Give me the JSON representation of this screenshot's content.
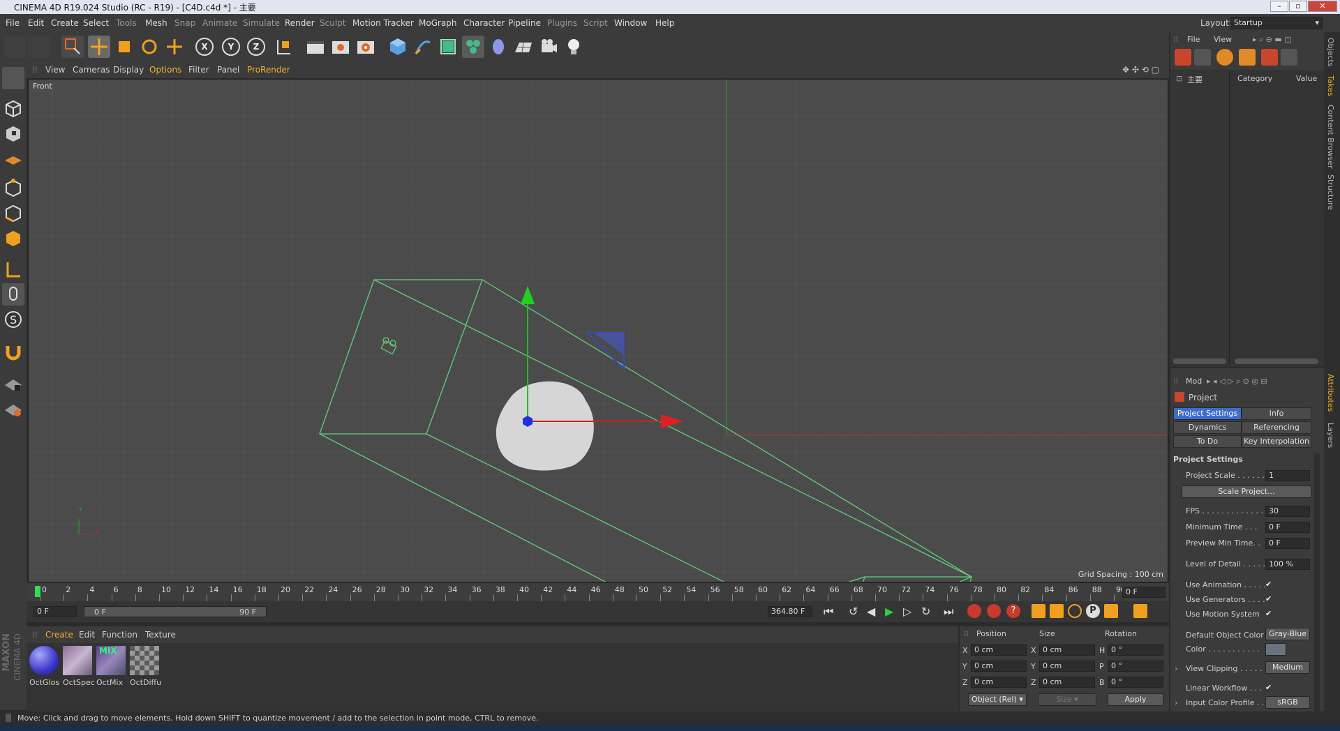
{
  "window": {
    "title": "CINEMA 4D R19.024 Studio (RC - R19) - [C4D.c4d *] - 主要",
    "layout_label": "Layout:",
    "layout_value": "Startup"
  },
  "menu": [
    "File",
    "Edit",
    "Create",
    "Select",
    "Tools",
    "Mesh",
    "Snap",
    "Animate",
    "Simulate",
    "Render",
    "Sculpt",
    "Motion Tracker",
    "MoGraph",
    "Character",
    "Pipeline",
    "Plugins",
    "Script",
    "Window",
    "Help"
  ],
  "menu_dim": [
    false,
    false,
    false,
    false,
    true,
    false,
    true,
    true,
    true,
    false,
    true,
    false,
    false,
    false,
    false,
    true,
    true,
    false,
    false
  ],
  "toolbar": {
    "x_label": "X",
    "y_label": "Y",
    "z_label": "Z"
  },
  "viewport_menu": [
    "View",
    "Cameras",
    "Display",
    "Options",
    "Filter",
    "Panel",
    "ProRender"
  ],
  "viewport": {
    "name": "Front",
    "grid_spacing": "Grid Spacing : 100 cm",
    "axis_y": "Y",
    "axis_x": "X"
  },
  "timeline": {
    "ticks": [
      "0",
      "2",
      "4",
      "6",
      "8",
      "10",
      "12",
      "14",
      "16",
      "18",
      "20",
      "22",
      "24",
      "26",
      "28",
      "30",
      "32",
      "34",
      "36",
      "38",
      "40",
      "42",
      "44",
      "46",
      "48",
      "50",
      "52",
      "54",
      "56",
      "58",
      "60",
      "62",
      "64",
      "66",
      "68",
      "70",
      "72",
      "74",
      "76",
      "78",
      "80",
      "82",
      "84",
      "86",
      "88",
      "90"
    ],
    "current_frame": "0 F",
    "start_field": "0 F",
    "range_start": "0 F",
    "range_end": "90 F",
    "end_field": "364.80 F"
  },
  "materials": {
    "menu": [
      "Create",
      "Edit",
      "Function",
      "Texture"
    ],
    "items": [
      "OctGlos",
      "OctSpec",
      "OctMix",
      "OctDiffu"
    ],
    "mix_badge": "MIX",
    "brand": "MAXON",
    "brand2": "CINEMA 4D"
  },
  "coordinates": {
    "headers": [
      "Position",
      "Size",
      "Rotation"
    ],
    "rows": [
      {
        "axis": "X",
        "pos": "0 cm",
        "saxis": "X",
        "size": "0 cm",
        "raxis": "H",
        "rot": "0 °"
      },
      {
        "axis": "Y",
        "pos": "0 cm",
        "saxis": "Y",
        "size": "0 cm",
        "raxis": "P",
        "rot": "0 °"
      },
      {
        "axis": "Z",
        "pos": "0 cm",
        "saxis": "Z",
        "size": "0 cm",
        "raxis": "B",
        "rot": "0 °"
      }
    ],
    "mode": "Object (Rel)",
    "size_mode": "Size",
    "apply": "Apply"
  },
  "objects_panel": {
    "menu": [
      "File",
      "View"
    ],
    "root": "主要",
    "col_category": "Category",
    "col_value": "Value"
  },
  "attributes": {
    "mode": "Mod",
    "object": "Project",
    "tabs": [
      "Project Settings",
      "Info",
      "Dynamics",
      "Referencing",
      "To Do",
      "Key Interpolation"
    ],
    "section": "Project Settings",
    "project_scale_label": "Project Scale . . . . . .",
    "project_scale": "1",
    "scale_btn": "Scale Project...",
    "fps_label": "FPS . . . . . . . . . . . . .",
    "fps": "30",
    "min_time_label": "Minimum Time . . .",
    "min_time": "0 F",
    "preview_min_label": "Preview Min Time. .",
    "preview_min": "0 F",
    "lod_label": "Level of Detail . . . . .",
    "lod": "100 %",
    "use_anim_label": "Use Animation . . . . .",
    "use_gen_label": "Use Generators . . . .",
    "use_motion_label": "Use Motion System",
    "default_color_label": "Default Object Color",
    "default_color": "Gray-Blue",
    "color_label": "Color . . . . . . . . . . .",
    "view_clip_label": "View Clipping . . . . .",
    "view_clip": "Medium",
    "linear_label": "Linear Workflow . . .",
    "input_profile_label": "Input Color Profile . .",
    "input_profile": "sRGB",
    "check": "✔"
  },
  "right_tabs": [
    "Objects",
    "Takes",
    "Content Browser",
    "Structure",
    "Attributes",
    "Layers"
  ],
  "status": "Move: Click and drag to move elements. Hold down SHIFT to quantize movement / add to the selection in point mode, CTRL to remove."
}
